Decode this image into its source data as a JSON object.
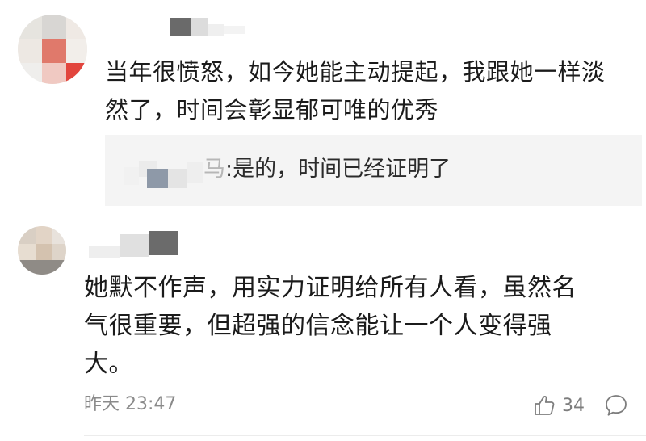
{
  "comments": [
    {
      "text_lines": [
        "当年很愤怒，如今她能主动提起，我跟她一样淡",
        "然了，时间会彰显郁可唯的优秀"
      ],
      "reply": {
        "name_suffix": "马",
        "text": ":是的，时间已经证明了"
      }
    },
    {
      "text_lines": [
        "她默不作声，用实力证明给所有人看，虽然名",
        "气很重要，但超强的信念能让一个人变得强",
        "大。"
      ],
      "time": "昨天 23:47",
      "likes": "34"
    }
  ],
  "icons": {
    "like": "thumbs-up-icon",
    "comment": "comment-bubble-icon"
  },
  "colors": {
    "text": "#1b1b1b",
    "meta": "#8a8a8a",
    "reply_bg": "#f4f4f4"
  }
}
